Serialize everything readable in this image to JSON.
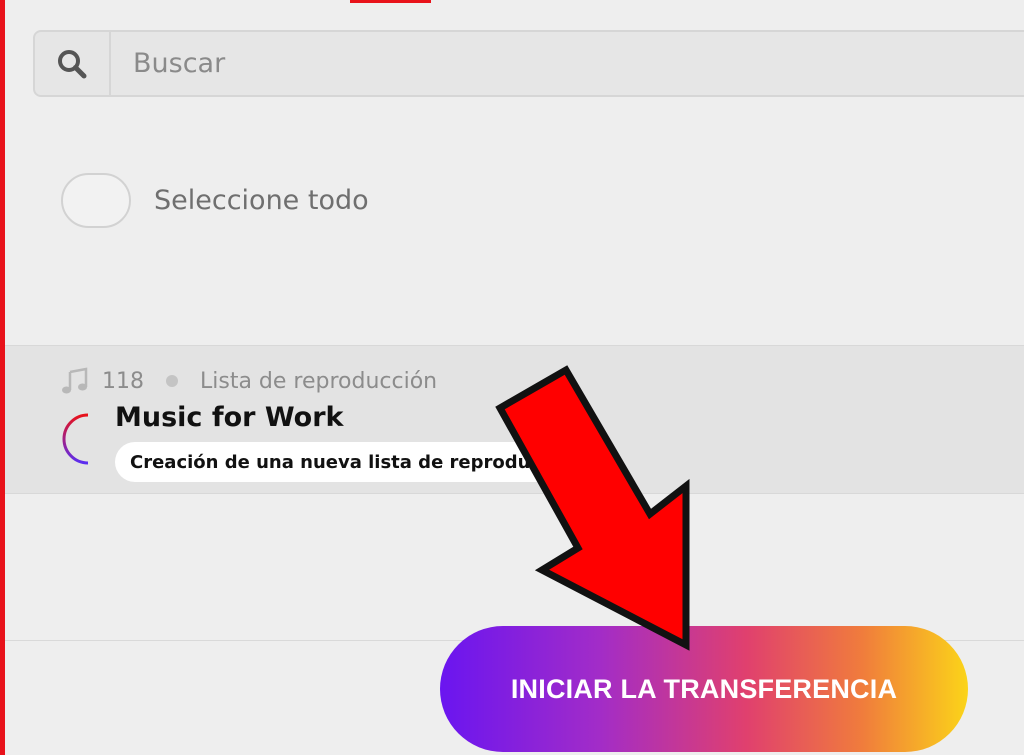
{
  "search": {
    "placeholder": "Buscar",
    "icon": "search-icon"
  },
  "select_all": {
    "label": "Seleccione todo",
    "checked": false
  },
  "playlist": {
    "track_count": "118",
    "type_label": "Lista de reproducción",
    "title": "Music for Work",
    "status": "Creación de una nueva lista de reproducción",
    "icons": [
      "music-note-icon",
      "loading-spinner-icon"
    ]
  },
  "cta": {
    "label": "INICIAR LA TRANSFERENCIA"
  },
  "colors": {
    "accent_red": "#e8121a",
    "gradient_start": "#6a15f0",
    "gradient_end": "#fbd419"
  }
}
